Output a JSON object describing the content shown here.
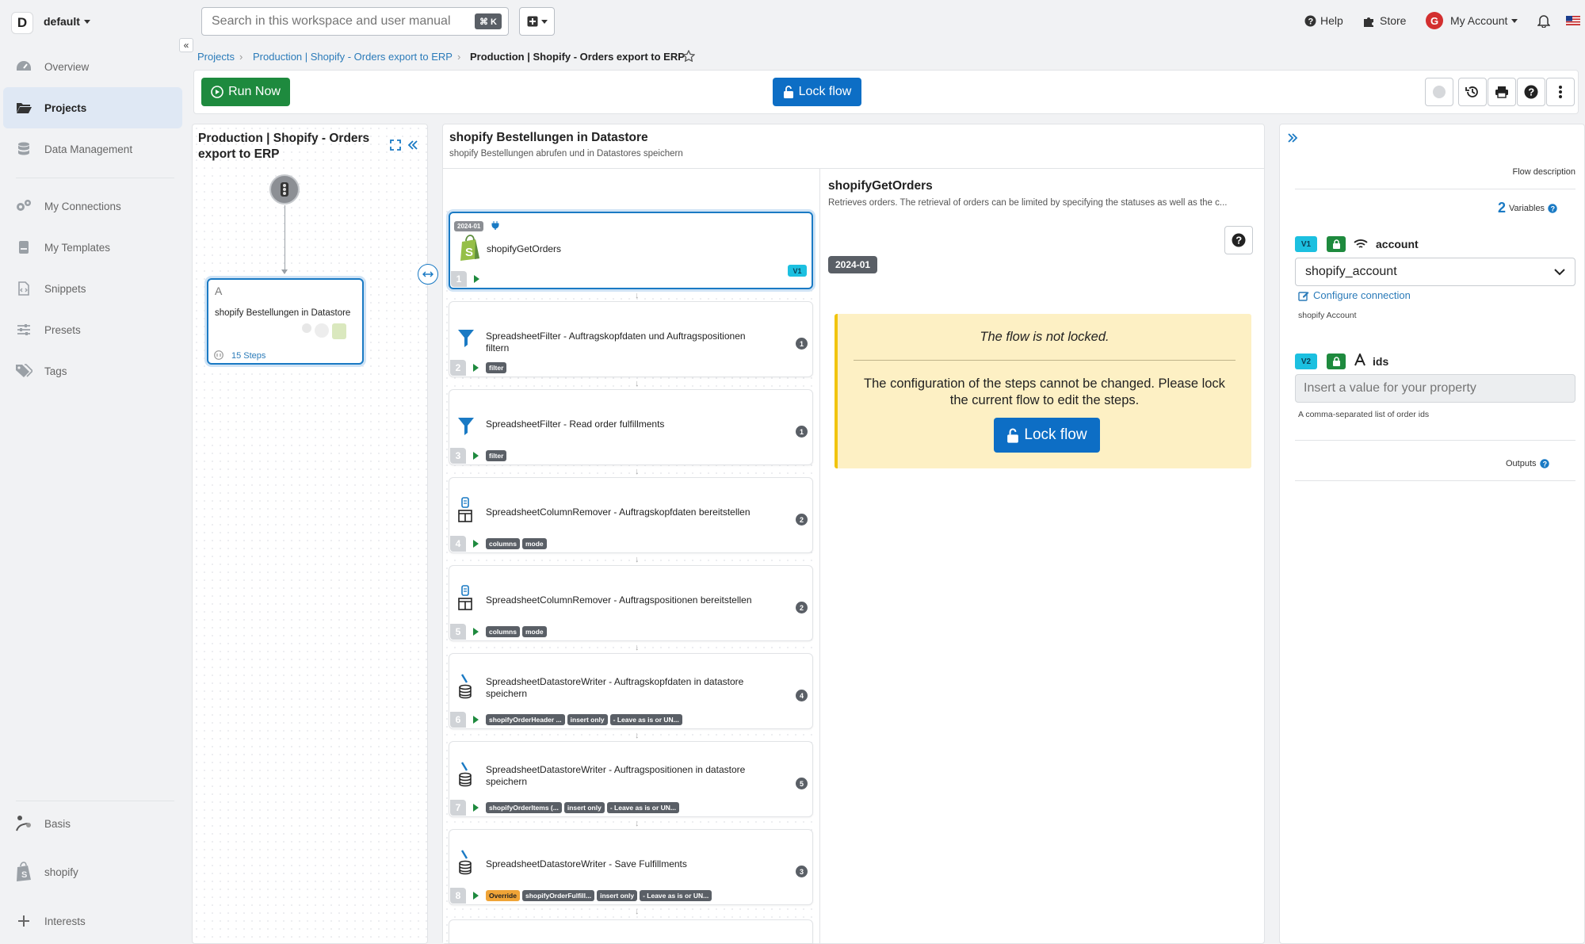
{
  "workspace": {
    "badge": "D",
    "name": "default"
  },
  "sidebar": {
    "items": [
      {
        "label": "Overview",
        "icon": "dashboard-icon"
      },
      {
        "label": "Projects",
        "icon": "folder-icon",
        "active": true
      },
      {
        "label": "Data Management",
        "icon": "database-icon"
      },
      {
        "label": "My Connections",
        "icon": "gears-icon"
      },
      {
        "label": "My Templates",
        "icon": "template-icon"
      },
      {
        "label": "Snippets",
        "icon": "file-code-icon"
      },
      {
        "label": "Presets",
        "icon": "sliders-icon"
      },
      {
        "label": "Tags",
        "icon": "tags-icon"
      }
    ],
    "bottom": [
      {
        "label": "Basis",
        "icon": "basis-icon"
      },
      {
        "label": "shopify",
        "icon": "shopify-icon"
      },
      {
        "label": "Interests",
        "icon": "plus-icon"
      }
    ],
    "collapse_glyph": "«"
  },
  "topbar": {
    "search_placeholder": "Search in this workspace and user manual",
    "search_kbd": "⌘ K",
    "help": "Help",
    "store": "Store",
    "avatar_letter": "G",
    "account": "My Account"
  },
  "breadcrumb": {
    "items": [
      "Projects",
      "Production | Shopify - Orders export to ERP"
    ],
    "current": "Production | Shopify - Orders export to ERP"
  },
  "toolbar": {
    "run_now": "Run Now",
    "lock_flow": "Lock flow"
  },
  "left_panel": {
    "title": "Production | Shopify - Orders export to ERP",
    "node_letter": "A",
    "node_title": "shopify Bestellungen in Datastore",
    "node_steps": "15 Steps"
  },
  "center_panel": {
    "title": "shopify Bestellungen in Datastore",
    "subtitle": "shopify Bestellungen abrufen und in Datastores speichern"
  },
  "steps": [
    {
      "num": "1",
      "title": "shopifyGetOrders",
      "version": "2024-01",
      "badge": "V1",
      "icon": "shopify-icon",
      "tags": []
    },
    {
      "num": "2",
      "title": "SpreadsheetFilter - Auftragskopfdaten und Auftragspositionen filtern",
      "count": "1",
      "icon": "filter-icon",
      "tags": [
        {
          "t": "filter"
        }
      ]
    },
    {
      "num": "3",
      "title": "SpreadsheetFilter - Read order fulfillments",
      "count": "1",
      "icon": "filter-icon",
      "tags": [
        {
          "t": "filter"
        }
      ]
    },
    {
      "num": "4",
      "title": "SpreadsheetColumnRemover - Auftragskopfdaten bereitstellen",
      "count": "2",
      "icon": "table-icon",
      "tags": [
        {
          "t": "columns"
        },
        {
          "t": "mode"
        }
      ]
    },
    {
      "num": "5",
      "title": "SpreadsheetColumnRemover - Auftragspositionen bereitstellen",
      "count": "2",
      "icon": "table-icon",
      "tags": [
        {
          "t": "columns"
        },
        {
          "t": "mode"
        }
      ]
    },
    {
      "num": "6",
      "title": "SpreadsheetDatastoreWriter - Auftragskopfdaten in datastore speichern",
      "count": "4",
      "icon": "datastore-icon",
      "tags": [
        {
          "t": "shopifyOrderHeader ..."
        },
        {
          "t": "insert only"
        },
        {
          "t": "- Leave as is or UN..."
        }
      ]
    },
    {
      "num": "7",
      "title": "SpreadsheetDatastoreWriter - Auftragspositionen in datastore speichern",
      "count": "5",
      "icon": "datastore-icon",
      "tags": [
        {
          "t": "shopifyOrderItems (..."
        },
        {
          "t": "insert only"
        },
        {
          "t": "- Leave as is or UN..."
        }
      ]
    },
    {
      "num": "8",
      "title": "SpreadsheetDatastoreWriter - Save Fulfillments",
      "count": "3",
      "icon": "datastore-icon",
      "tags": [
        {
          "t": "Override",
          "orange": true
        },
        {
          "t": "shopifyOrderFulfill..."
        },
        {
          "t": "insert only"
        },
        {
          "t": "- Leave as is or UN..."
        }
      ]
    }
  ],
  "detail": {
    "title": "shopifyGetOrders",
    "description": "Retrieves orders. The retrieval of orders can be limited by specifying the statuses as well as the c...",
    "version": "2024-01",
    "notice_title": "The flow is not locked.",
    "notice_body": "The configuration of the steps cannot be changed. Please lock the current flow to edit the steps.",
    "notice_button": "Lock flow"
  },
  "right_panel": {
    "flow_description": "Flow description",
    "variables_count": "2",
    "variables_label": "Variables",
    "vars": [
      {
        "badge": "V1",
        "name": "account",
        "value": "shopify_account",
        "link": "Configure connection",
        "hint": "shopify Account"
      },
      {
        "badge": "V2",
        "name": "ids",
        "placeholder": "Insert a value for your property",
        "hint": "A comma-separated list of order ids"
      }
    ],
    "outputs": "Outputs"
  },
  "colors": {
    "green": "#1e8a3e",
    "blue": "#0d6ec5",
    "link": "#2b7bb9",
    "notice_bg": "#fdf0c4",
    "cyan": "#1cc0e0"
  }
}
